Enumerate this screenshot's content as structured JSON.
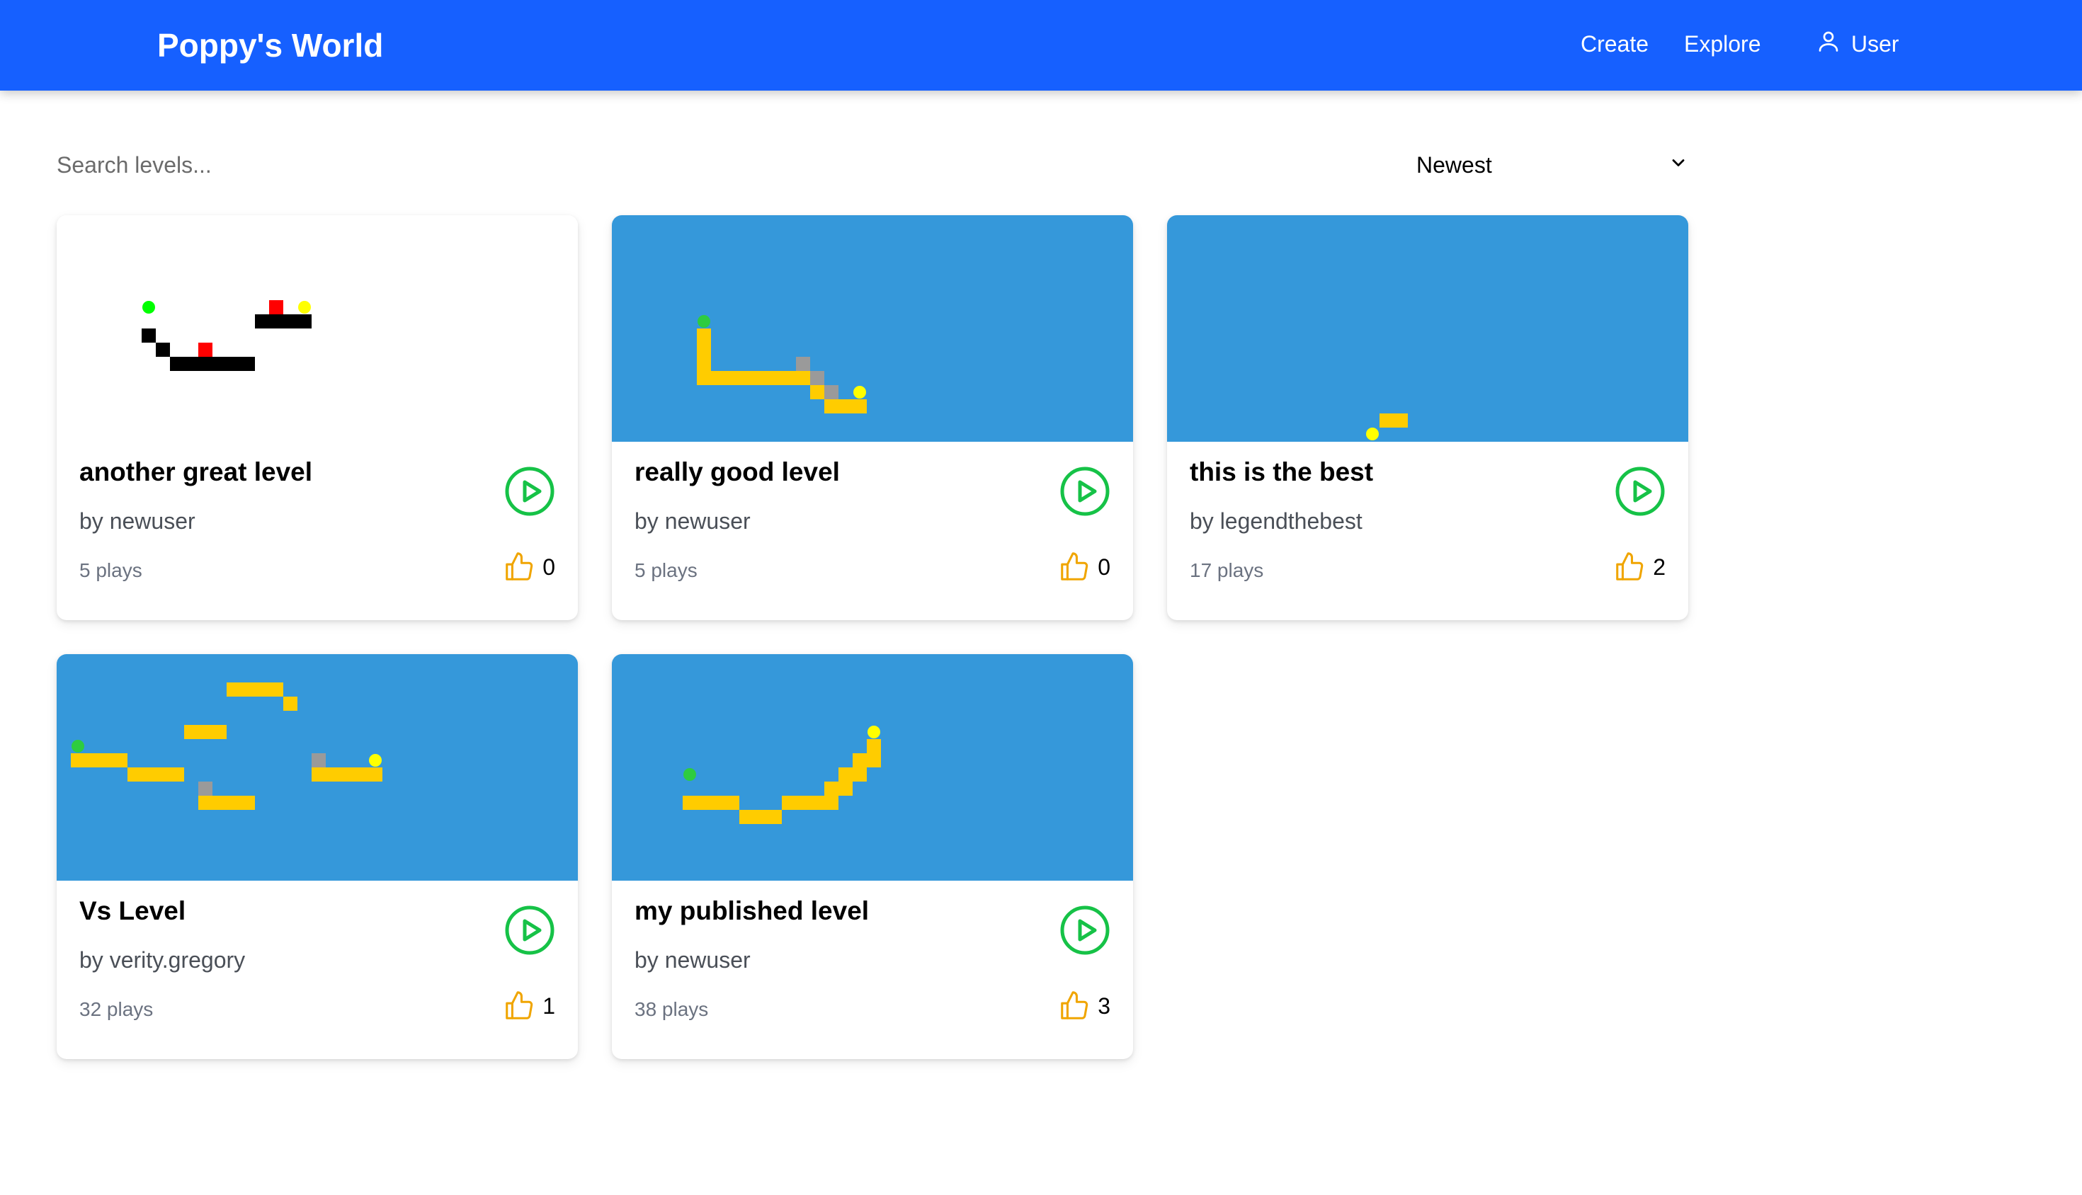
{
  "header": {
    "brand": "Poppy's World",
    "nav": {
      "create": "Create",
      "explore": "Explore",
      "user": "User"
    }
  },
  "search": {
    "placeholder": "Search levels...",
    "value": ""
  },
  "sort": {
    "selected": "Newest"
  },
  "levels": [
    {
      "title": "another great level",
      "author": "by newuser",
      "plays": "5 plays",
      "likes": "0",
      "background": "white"
    },
    {
      "title": "really good level",
      "author": "by newuser",
      "plays": "5 plays",
      "likes": "0",
      "background": "blue"
    },
    {
      "title": "this is the best",
      "author": "by legendthebest",
      "plays": "17 plays",
      "likes": "2",
      "background": "blue"
    },
    {
      "title": "Vs Level",
      "author": "by verity.gregory",
      "plays": "32 plays",
      "likes": "1",
      "background": "blue"
    },
    {
      "title": "my published level",
      "author": "by newuser",
      "plays": "38 plays",
      "likes": "3",
      "background": "blue"
    }
  ],
  "colors": {
    "header": "#1660ff",
    "thumb_blue": "#3598da",
    "platform": "#ffcc00",
    "play_green": "#16c247",
    "like_amber": "#f0a500",
    "start_green": "#2ecc40",
    "goal_yellow": "#ffff00",
    "hazard_red": "#ff0000"
  }
}
